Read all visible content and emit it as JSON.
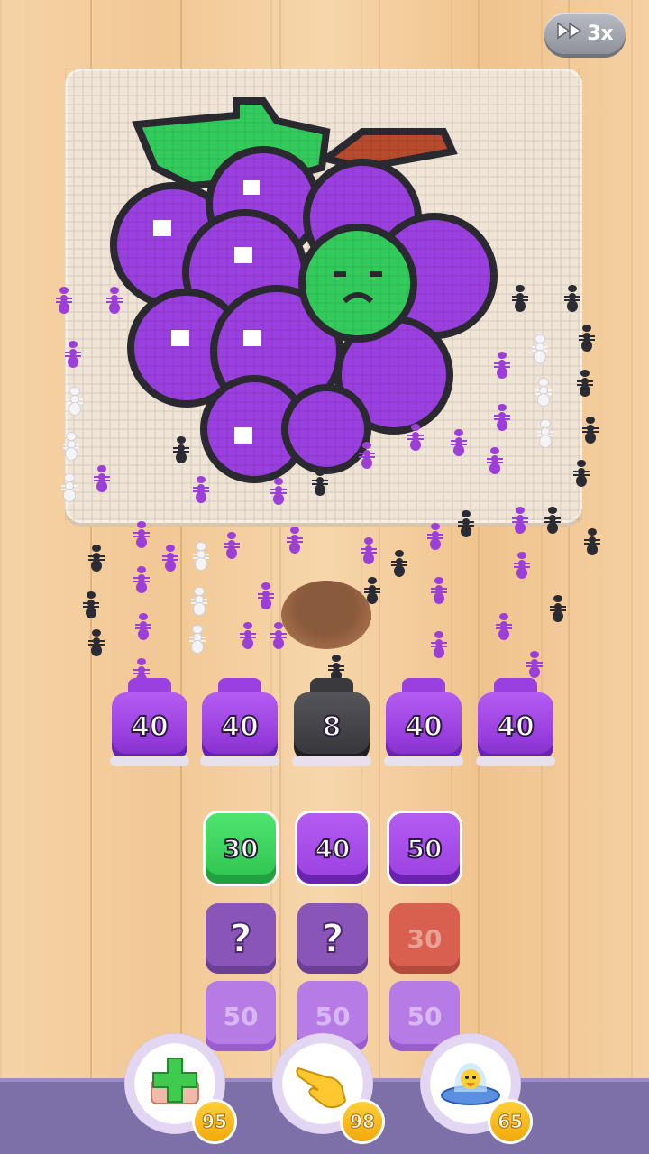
{
  "speed_button": {
    "label": "3x",
    "icon": "fast-forward-icon"
  },
  "board": {
    "picture": "grapes-pixel-art",
    "colors": {
      "grape": "#9a3fe0",
      "leaf": "#33cc5c",
      "stem": "#b84a2e",
      "outline": "#2a2a30"
    }
  },
  "jars": [
    {
      "count": "40",
      "color": "purple"
    },
    {
      "count": "40",
      "color": "purple"
    },
    {
      "count": "8",
      "color": "black"
    },
    {
      "count": "40",
      "color": "purple"
    },
    {
      "count": "40",
      "color": "purple"
    }
  ],
  "tiles": {
    "row1": [
      "30",
      "40",
      "50"
    ],
    "row2": [
      "?",
      "?",
      "30"
    ],
    "row3": [
      "50",
      "50",
      "50"
    ]
  },
  "boosters": [
    {
      "icon": "add-tile-icon",
      "count": "95"
    },
    {
      "icon": "hand-pointer-icon",
      "count": "98"
    },
    {
      "icon": "ufo-icon",
      "count": "65"
    }
  ]
}
